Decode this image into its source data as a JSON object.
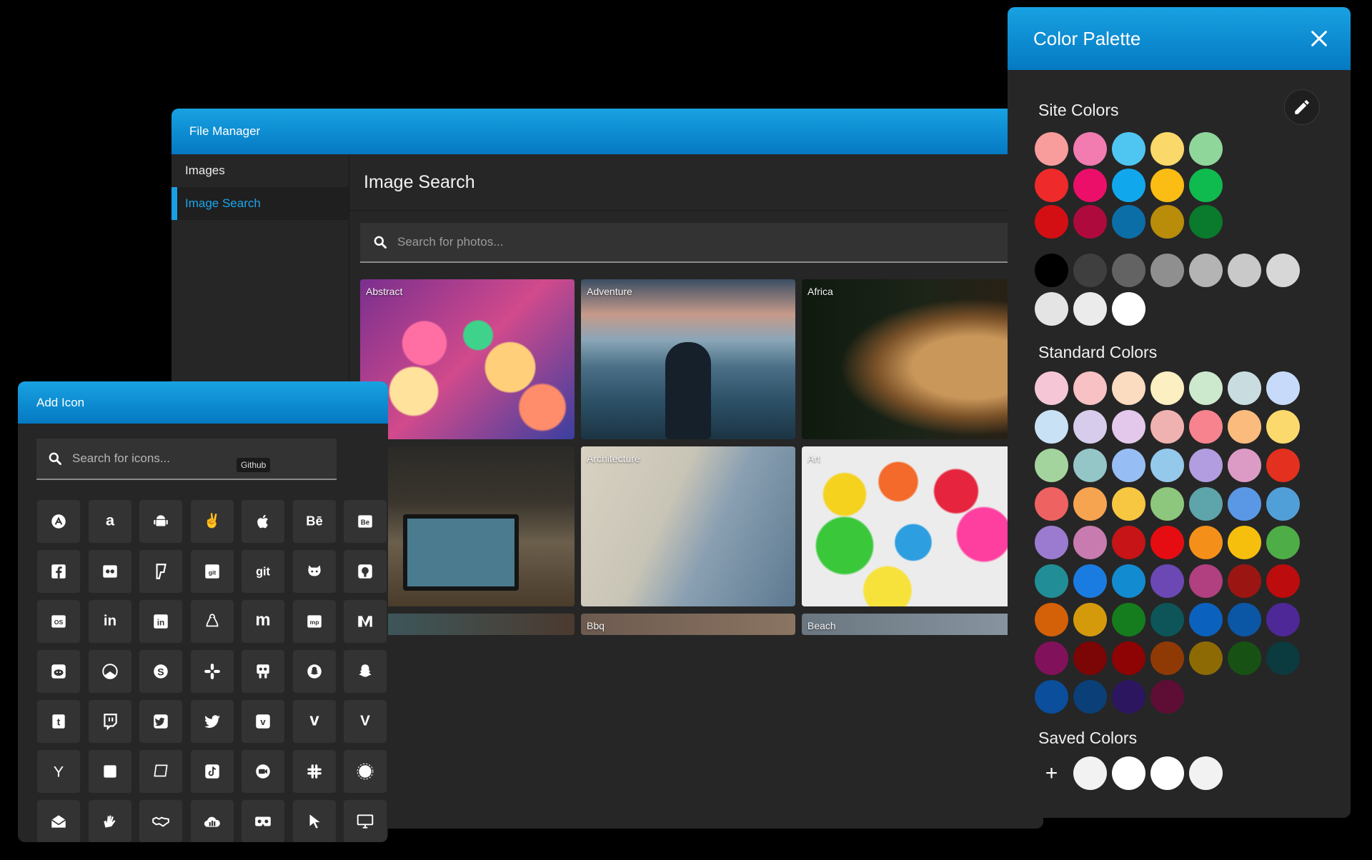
{
  "file_manager": {
    "title": "File Manager",
    "sidebar": [
      {
        "label": "Images",
        "active": false
      },
      {
        "label": "Image Search",
        "active": true
      }
    ],
    "main_title": "Image Search",
    "search_placeholder": "Search for photos...",
    "categories": [
      "Abstract",
      "Adventure",
      "Africa",
      "",
      "Architecture",
      "Art",
      "",
      "Bbq",
      "Beach"
    ]
  },
  "add_icon": {
    "title": "Add Icon",
    "search_placeholder": "Search for icons...",
    "tooltip": "Github",
    "icons": [
      "app-store-icon",
      "amazon-icon",
      "android-icon",
      "angellist-icon",
      "apple-icon",
      "behance-icon",
      "behance-square-icon",
      "facebook-icon",
      "flickr-icon",
      "foursquare-icon",
      "git-square-icon",
      "git-icon",
      "github-alt-icon",
      "github-icon",
      "lastfm-icon",
      "linkedin-in-icon",
      "linkedin-icon",
      "linux-icon",
      "meetup-icon",
      "mixcloud-icon",
      "medium-icon",
      "reddit-icon",
      "researchgate-icon",
      "skype-icon",
      "slack-icon",
      "slideshare-icon",
      "snapchat-ghost-icon",
      "snapchat-icon",
      "tumblr-icon",
      "twitch-icon",
      "twitter-square-icon",
      "twitter-icon",
      "vimeo-square-icon",
      "vimeo-icon",
      "vine-icon",
      "y-combinator-icon",
      "square-icon",
      "speech-bubble-icon",
      "tiktok-icon",
      "zoom-icon",
      "slack-hash-icon",
      "signal-icon",
      "envelope-open-icon",
      "sign-language-icon",
      "handshake-icon",
      "cloud-chart-icon",
      "vr-cardboard-icon",
      "cursor-icon",
      "desktop-icon"
    ]
  },
  "color_palette": {
    "title": "Color Palette",
    "site_colors_title": "Site Colors",
    "standard_colors_title": "Standard Colors",
    "saved_colors_title": "Saved Colors",
    "add_label": "+",
    "site_colors": [
      [
        "#f89c9c",
        "#f27bb0",
        "#4fc6f2",
        "#fbd86a",
        "#8fd69b"
      ],
      [
        "#ee2a2a",
        "#ec0f6a",
        "#11a7ec",
        "#fbbd13",
        "#0fba4e"
      ],
      [
        "#d30f13",
        "#ae0a3e",
        "#0b6ea6",
        "#b98c0a",
        "#0a7a2c"
      ]
    ],
    "gray_colors": [
      "#000000",
      "#3f3f3f",
      "#636363",
      "#8f8f8f",
      "#b4b4b4",
      "#c9c9c9",
      "#d7d7d7",
      "#e4e4e4",
      "#ebebeb",
      "#ffffff"
    ],
    "standard_colors": [
      [
        "#f5c7d6",
        "#f8c1c4",
        "#fbdcc1",
        "#fcefc1",
        "#cde9cd",
        "#c9dde0",
        "#c7dafa"
      ],
      [
        "#c8e1f5",
        "#d7cceb",
        "#e3c8ec",
        "#efb2b0",
        "#f6838e",
        "#fbbb7c",
        "#fbd96d"
      ],
      [
        "#a4d49e",
        "#94c6c8",
        "#97bef4",
        "#95c9eb",
        "#b19ddf",
        "#dc9bc5",
        "#e4301e"
      ],
      [
        "#ef6262",
        "#f7a451",
        "#f7c741",
        "#8dc67d",
        "#5ea4ab",
        "#5a98e6",
        "#519fd8"
      ],
      [
        "#9a7bd0",
        "#c87bae",
        "#c61417",
        "#e50d11",
        "#f49019",
        "#f6bf0d",
        "#4ead47"
      ],
      [
        "#218e97",
        "#1a7be0",
        "#128bd0",
        "#6b48b4",
        "#b0407f",
        "#9b1612",
        "#bc0c0d"
      ],
      [
        "#d46008",
        "#d59a0c",
        "#167d1e",
        "#0d5558",
        "#0b62be",
        "#0c56a6",
        "#4d2896"
      ],
      [
        "#82115b",
        "#7c0606",
        "#8e0303",
        "#8f3a04",
        "#8d6a04",
        "#175214",
        "#0b3a3f"
      ],
      [
        "#0a4e9c",
        "#0a3f78",
        "#2c1660",
        "#5e0e35"
      ]
    ],
    "saved_colors": [
      "#f2f2f2",
      "#ffffff",
      "#ffffff",
      "#f2f2f2"
    ]
  }
}
